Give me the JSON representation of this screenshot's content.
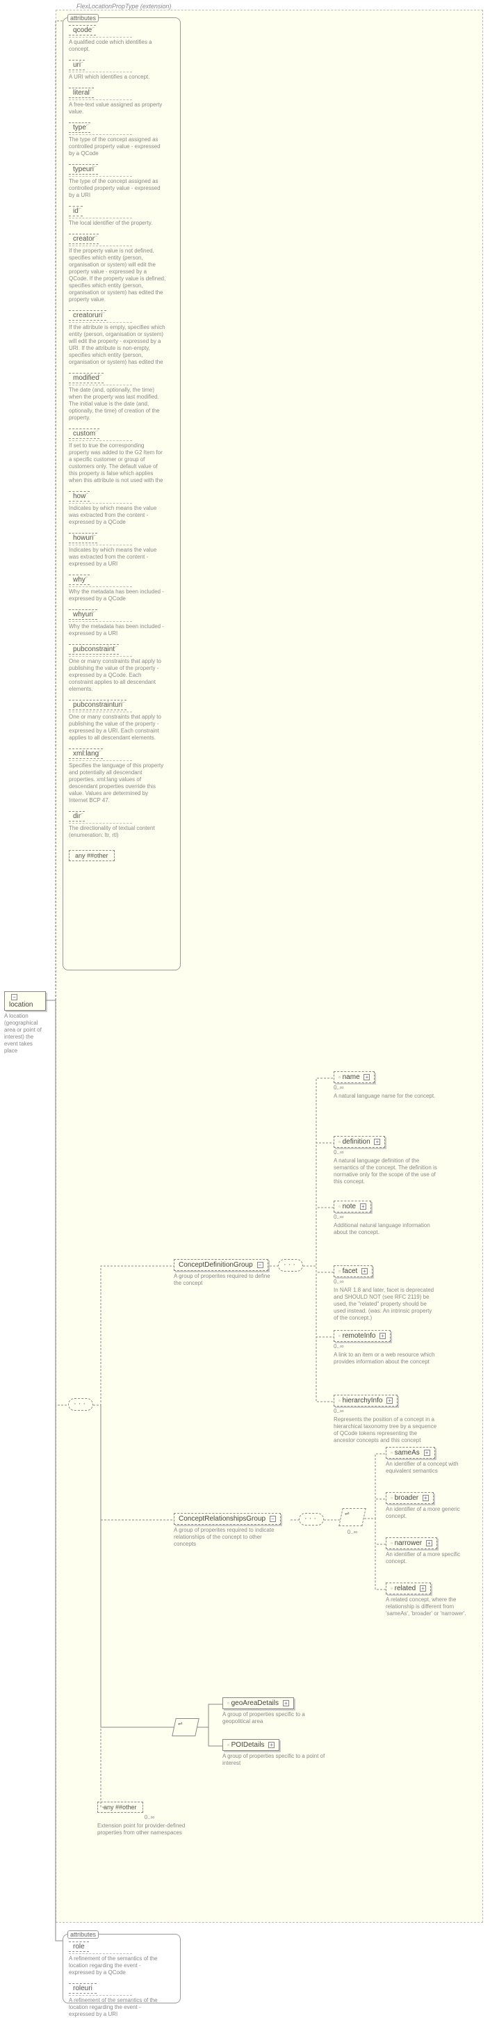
{
  "ext_label": "FlexLocationPropType (extension)",
  "root": {
    "name": "location",
    "desc": "A location (geographical area or point of interest) the event takes place"
  },
  "attributes_label": "attributes",
  "attributes": [
    {
      "name": "qcode",
      "desc": "A qualified code which identifies a concept."
    },
    {
      "name": "uri",
      "desc": "A URI which identifies a concept."
    },
    {
      "name": "literal",
      "desc": "A free-text value assigned as property value."
    },
    {
      "name": "type",
      "desc": "The type of the concept assigned as controlled property value - expressed by a QCode"
    },
    {
      "name": "typeuri",
      "desc": "The type of the concept assigned as controlled property value - expressed by a URI"
    },
    {
      "name": "id",
      "desc": "The local identifier of the property."
    },
    {
      "name": "creator",
      "desc": "If the property value is not defined, specifies which entity (person, organisation or system) will edit the property value - expressed by a QCode. If the property value is defined, specifies which entity (person, organisation or system) has edited the property value."
    },
    {
      "name": "creatoruri",
      "desc": "If the attribute is empty, specifies which entity (person, organisation or system) will edit the property - expressed by a URI. If the attribute is non-empty, specifies which entity (person, organisation or system) has edited the"
    },
    {
      "name": "modified",
      "desc": "The date (and, optionally, the time) when the property was last modified. The initial value is the date (and, optionally, the time) of creation of the property."
    },
    {
      "name": "custom",
      "desc": "If set to true the corresponding property was added to the G2 Item for a specific customer or group of customers only. The default value of this property is false which applies when this attribute is not used with the"
    },
    {
      "name": "how",
      "desc": "Indicates by which means the value was extracted from the content - expressed by a QCode"
    },
    {
      "name": "howuri",
      "desc": "Indicates by which means the value was extracted from the content - expressed by a URI"
    },
    {
      "name": "why",
      "desc": "Why the metadata has been included - expressed by a QCode"
    },
    {
      "name": "whyuri",
      "desc": "Why the metadata has been included - expressed by a URI"
    },
    {
      "name": "pubconstraint",
      "desc": "One or many constraints that apply to publishing the value of the property - expressed by a QCode. Each constraint applies to all descendant elements."
    },
    {
      "name": "pubconstrainturi",
      "desc": "One or many constraints that apply to publishing the value of the property - expressed by a URI. Each constraint applies to all descendant elements."
    },
    {
      "name": "xml:lang",
      "desc": "Specifies the language of this property and potentially all descendant properties. xml:lang values of descendant properties override this value. Values are determined by Internet BCP 47."
    },
    {
      "name": "dir",
      "desc": "The directionality of textual content (enumeration: ltr, rtl)"
    }
  ],
  "any_attr": "any ##other",
  "groups": {
    "cdg": {
      "name": "ConceptDefinitionGroup",
      "desc": "A group of properites required to define the concept"
    },
    "crg": {
      "name": "ConceptRelationshipsGroup",
      "desc": "A group of properites required to indicate relationships of the concept to other concepts"
    }
  },
  "cdg_children": [
    {
      "name": "name",
      "desc": "A natural language name for the concept."
    },
    {
      "name": "definition",
      "desc": "A natural language definition of the semantics of the concept. The definition is normative only for the scope of the use of this concept."
    },
    {
      "name": "note",
      "desc": "Additional natural language information about the concept."
    },
    {
      "name": "facet",
      "desc": "In NAR 1.8 and later, facet is deprecated and SHOULD NOT (see RFC 2119) be used, the \"related\" property should be used instead. (was: An intrinsic property of the concept.)"
    },
    {
      "name": "remoteInfo",
      "desc": "A link to an item or a web resource which provides information about the concept"
    },
    {
      "name": "hierarchyInfo",
      "desc": "Represents the position of a concept in a hierarchical taxonomy tree by a sequence of QCode tokens representing the ancestor concepts and this concept"
    }
  ],
  "crg_children": [
    {
      "name": "sameAs",
      "desc": "An identifier of a concept with equivalent semantics"
    },
    {
      "name": "broader",
      "desc": "An identifier of a more generic concept."
    },
    {
      "name": "narrower",
      "desc": "An identifier of a more specific concept."
    },
    {
      "name": "related",
      "desc": "A related concept, where the relationship is different from 'sameAs', 'broader' or 'narrower'."
    }
  ],
  "choice_children": [
    {
      "name": "geoAreaDetails",
      "desc": "A group of properties specific to a geopolitical area"
    },
    {
      "name": "POIDetails",
      "desc": "A group of properties specific to a point of interest"
    }
  ],
  "any_elem": {
    "label": "any ##other",
    "card": "0..∞",
    "desc": "Extension point for provider-defined properties from other namespaces"
  },
  "bottom_attrs": [
    {
      "name": "role",
      "desc": "A refinement of the semantics of the location regarding the event - expressed by a QCode"
    },
    {
      "name": "roleuri",
      "desc": "A refinement of the semantics of the location regarding the event - expressed by a URI"
    }
  ],
  "zero_inf": "0..∞"
}
